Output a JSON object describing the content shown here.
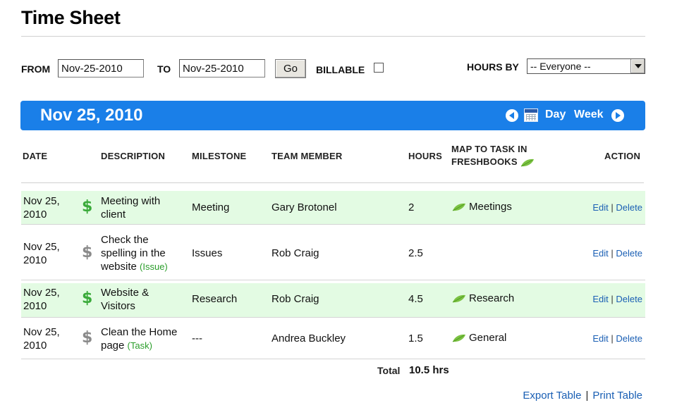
{
  "page": {
    "title": "Time Sheet"
  },
  "filters": {
    "from_label": "FROM",
    "from_value": "Nov-25-2010",
    "to_label": "TO",
    "to_value": "Nov-25-2010",
    "go_label": "Go",
    "billable_label": "BILLABLE",
    "billable_checked": false,
    "hours_by_label": "HOURS BY",
    "hours_by_value": "-- Everyone --"
  },
  "datebar": {
    "title": "Nov 25, 2010",
    "day_label": "Day",
    "week_label": "Week",
    "color": "#1a7fe8"
  },
  "table": {
    "headers": {
      "date": "DATE",
      "description": "DESCRIPTION",
      "milestone": "MILESTONE",
      "team_member": "TEAM MEMBER",
      "hours": "HOURS",
      "map_line1": "MAP TO TASK IN",
      "map_line2": "FRESHBOOKS",
      "action": "ACTION"
    },
    "rows": [
      {
        "date_line1": "Nov 25,",
        "date_line2": "2010",
        "billable": true,
        "desc_line1": "Meeting with",
        "desc_line2": "client",
        "desc_line3": "",
        "tag": "",
        "milestone": "Meeting",
        "team_member": "Gary Brotonel",
        "hours": "2",
        "map_task": "Meetings",
        "edit": "Edit",
        "delete": "Delete"
      },
      {
        "date_line1": "Nov 25,",
        "date_line2": "2010",
        "billable": false,
        "desc_line1": "Check the",
        "desc_line2": "spelling in the",
        "desc_line3": "website",
        "tag": "(Issue)",
        "milestone": "Issues",
        "team_member": "Rob Craig",
        "hours": "2.5",
        "map_task": "",
        "edit": "Edit",
        "delete": "Delete"
      },
      {
        "date_line1": "Nov 25,",
        "date_line2": "2010",
        "billable": true,
        "desc_line1": "Website &",
        "desc_line2": "Visitors",
        "desc_line3": "",
        "tag": "",
        "milestone": "Research",
        "team_member": "Rob Craig",
        "hours": "4.5",
        "map_task": "Research",
        "edit": "Edit",
        "delete": "Delete"
      },
      {
        "date_line1": "Nov 25,",
        "date_line2": "2010",
        "billable": false,
        "desc_line1": "Clean the Home",
        "desc_line2": "page",
        "desc_line3": "",
        "tag": "(Task)",
        "milestone": "---",
        "team_member": "Andrea Buckley",
        "hours": "1.5",
        "map_task": "General",
        "edit": "Edit",
        "delete": "Delete"
      }
    ],
    "dollar_sign": "$",
    "separator": "|"
  },
  "total": {
    "label": "Total",
    "value": "10.5 hrs"
  },
  "footer": {
    "export_label": "Export Table",
    "print_label": "Print Table",
    "separator": "|"
  },
  "colors": {
    "billable_row": "#e3fbe3",
    "billable_dollar": "#3aaa3a",
    "nonbillable_dollar": "#8a8a8a",
    "link": "#1a5fb4",
    "tag": "#2a9d2a"
  }
}
